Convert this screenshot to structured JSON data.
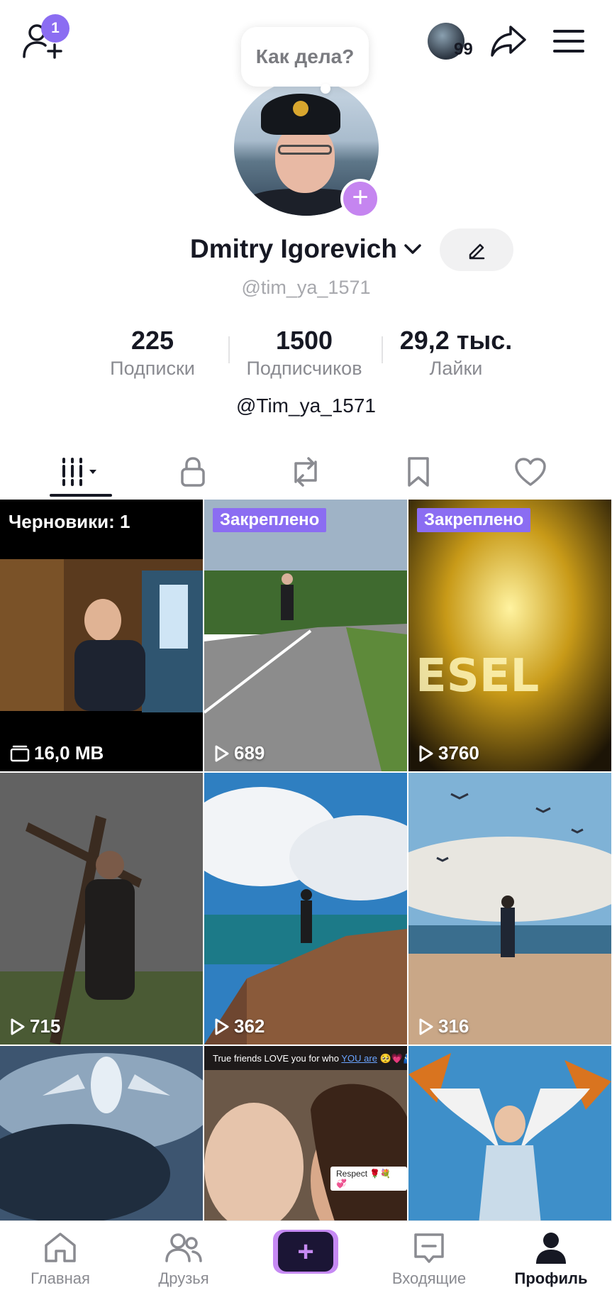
{
  "header": {
    "friend_requests_count": "1",
    "stories_count": "99"
  },
  "profile": {
    "status_bubble": "Как дела?",
    "display_name": "Dmitry Igorevich",
    "handle": "@tim_ya_1571",
    "bio": "@Tim_ya_1571",
    "stats": [
      {
        "value": "225",
        "label": "Подписки"
      },
      {
        "value": "1500",
        "label": "Подписчиков"
      },
      {
        "value": "29,2 тыс.",
        "label": "Лайки"
      }
    ]
  },
  "tabs": [
    {
      "icon": "videos-grid-icon",
      "active": true
    },
    {
      "icon": "lock-icon",
      "active": false
    },
    {
      "icon": "repost-icon",
      "active": false
    },
    {
      "icon": "bookmark-icon",
      "active": false
    },
    {
      "icon": "heart-icon",
      "active": false
    }
  ],
  "videos": [
    {
      "kind": "draft",
      "label": "Черновики: 1",
      "size": "16,0 MB"
    },
    {
      "pinned_label": "Закреплено",
      "views": "689"
    },
    {
      "pinned_label": "Закреплено",
      "views": "3760"
    },
    {
      "views": "715"
    },
    {
      "views": "362"
    },
    {
      "views": "316"
    },
    {
      "views": ""
    },
    {
      "caption": "True friends LOVE you for who",
      "caption_link": "YOU are",
      "caption_emoji": "🥺💗🫂",
      "sticker": "Respect 🌹💐💞",
      "views": ""
    },
    {
      "views": ""
    }
  ],
  "bottom_nav": [
    {
      "label": "Главная",
      "icon": "home-icon"
    },
    {
      "label": "Друзья",
      "icon": "friends-icon"
    },
    {
      "label": "",
      "icon": "plus-icon"
    },
    {
      "label": "Входящие",
      "icon": "inbox-icon"
    },
    {
      "label": "Профиль",
      "icon": "profile-icon",
      "active": true
    }
  ],
  "colors": {
    "accent_purple": "#8b6df2",
    "create_button": "#c68af3",
    "text_primary": "#161823",
    "text_secondary": "#8a8b91"
  }
}
